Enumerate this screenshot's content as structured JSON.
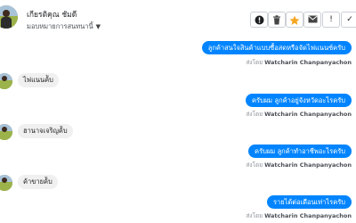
{
  "header": {
    "contact_name": "เกียรติคุณ ชัมดี",
    "assign_label": "มอบหมายการสนทนานี้",
    "toolbar": {
      "alert_icon": "!",
      "more_icon": "!",
      "done_icon": "✓"
    }
  },
  "messages": [
    {
      "direction": "out",
      "text": "ลูกค้าสนใจสินค้าแบบซื้อสดหรือจัดไฟแนนซ์ครับ",
      "sent_by_prefix": "ส่งโดย",
      "sent_by": "Watcharin Chanpanyachon"
    },
    {
      "direction": "in",
      "text": "ไฟแนนค้ับ"
    },
    {
      "direction": "out",
      "text": "ครับผม ลูกค้าอยู่จังหวัดอะไรครับ",
      "sent_by_prefix": "ส่งโดย",
      "sent_by": "Watcharin Chanpanyachon"
    },
    {
      "direction": "in",
      "text": "ฮานาจเจริญค้ับ"
    },
    {
      "direction": "out",
      "text": "ครับผม ลูกค้าทำอาชีพอะไรครับ",
      "sent_by_prefix": "ส่งโดย",
      "sent_by": "Watcharin Chanpanyachon"
    },
    {
      "direction": "in",
      "text": "ค้าขายค้ับ"
    },
    {
      "direction": "out",
      "text": "รายได้ต่อเดือนเท่าไรครับ",
      "sent_by_prefix": "ส่งโดย",
      "sent_by": "Watcharin Chanpanyachon"
    }
  ],
  "colors": {
    "accent": "#0084ff",
    "incoming_bubble": "#f1f0f0",
    "star": "#f5a623"
  }
}
